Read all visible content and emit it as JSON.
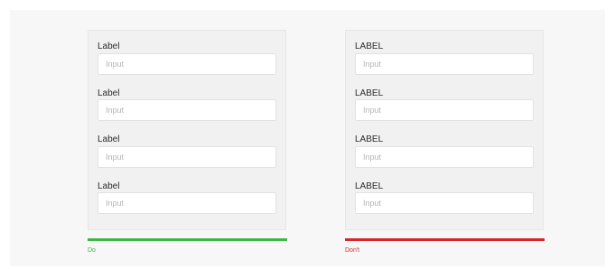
{
  "colors": {
    "do": "#3db547",
    "dont": "#d6262c"
  },
  "examples": [
    {
      "verdict": "Do",
      "fields": [
        {
          "label": "Label",
          "placeholder": "Input"
        },
        {
          "label": "Label",
          "placeholder": "Input"
        },
        {
          "label": "Label",
          "placeholder": "Input"
        },
        {
          "label": "Label",
          "placeholder": "Input"
        }
      ]
    },
    {
      "verdict": "Don't",
      "fields": [
        {
          "label": "LABEL",
          "placeholder": "Input"
        },
        {
          "label": "LABEL",
          "placeholder": "Input"
        },
        {
          "label": "LABEL",
          "placeholder": "Input"
        },
        {
          "label": "LABEL",
          "placeholder": "Input"
        }
      ]
    }
  ]
}
